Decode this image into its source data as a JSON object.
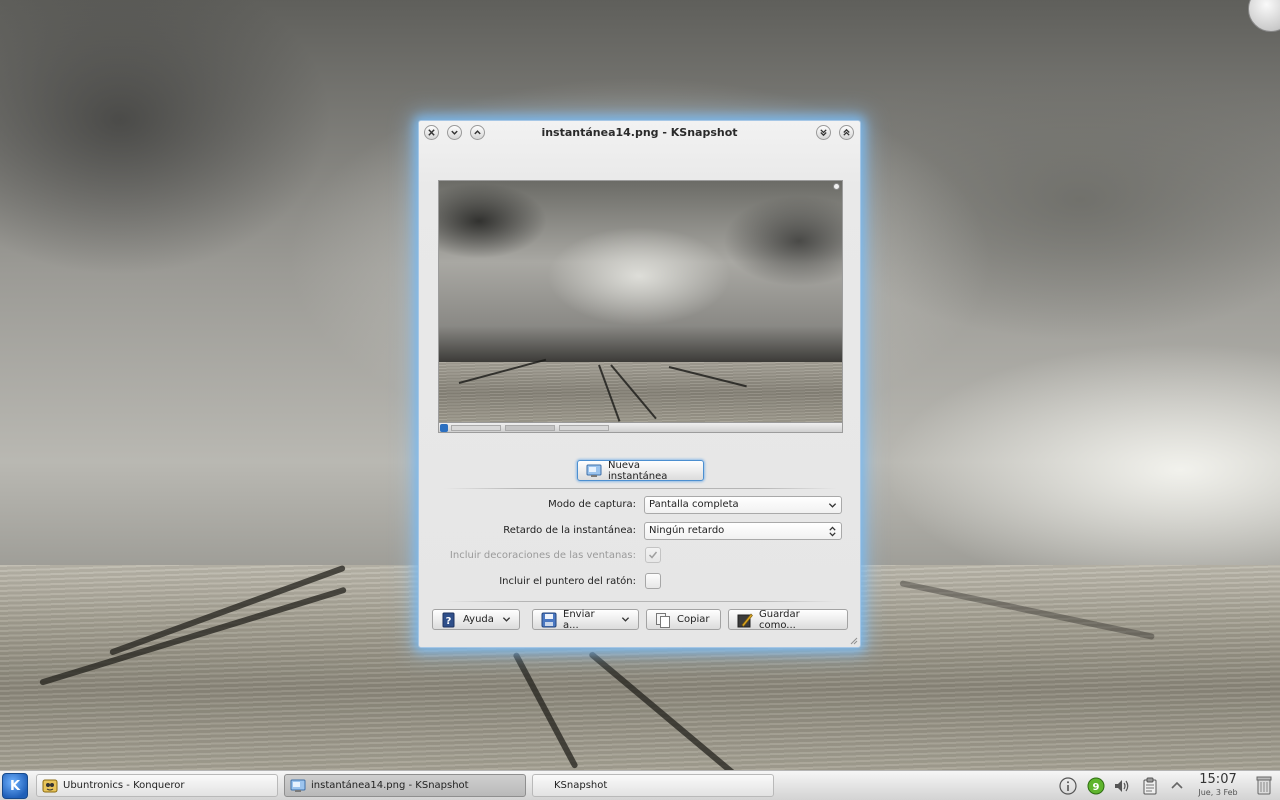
{
  "window": {
    "title": "instantánea14.png - KSnapshot",
    "new_snapshot_label": "Nueva instantánea",
    "capture_mode_label": "Modo de captura:",
    "capture_mode_value": "Pantalla completa",
    "delay_label": "Retardo de la instantánea:",
    "delay_value": "Ningún retardo",
    "include_decorations_label": "Incluir decoraciones de las ventanas:",
    "include_decorations_checked": true,
    "include_decorations_enabled": false,
    "include_pointer_label": "Incluir el puntero del ratón:",
    "include_pointer_checked": false,
    "buttons": {
      "help": "Ayuda",
      "send": "Enviar a...",
      "copy": "Copiar",
      "save_as": "Guardar como..."
    }
  },
  "taskbar": {
    "tasks": [
      {
        "label": "Ubuntronics - Konqueror",
        "active": false,
        "icon": "konqueror-icon"
      },
      {
        "label": "instantánea14.png - KSnapshot",
        "active": true,
        "icon": "ksnapshot-icon"
      },
      {
        "label": "KSnapshot",
        "active": false,
        "icon": "none"
      }
    ],
    "clock_time": "15:07",
    "clock_date": "Jue, 3 Feb",
    "tray_badge": "9"
  },
  "colors": {
    "window_glow": "#7ab9f0",
    "kmenu_blue": "#1f5fb8",
    "focus_blue": "#4c8fd0"
  }
}
